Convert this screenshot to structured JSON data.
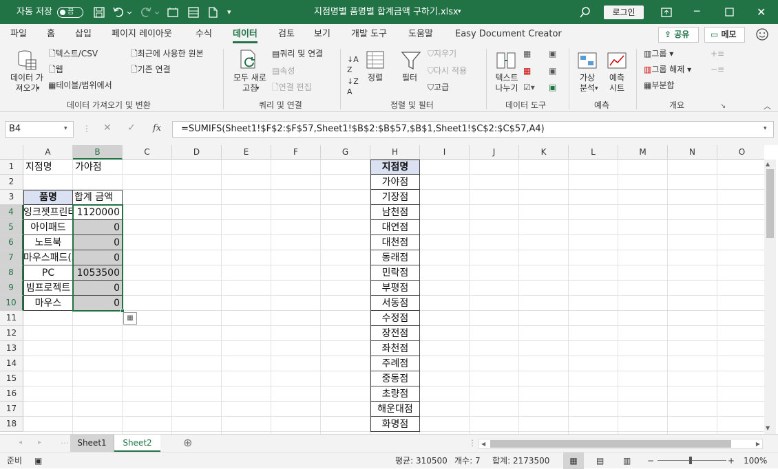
{
  "titlebar": {
    "autosave_label": "자동 저장",
    "autosave_state": "끔",
    "filename": "지점명별 품명별 합계금액 구하기.xlsx",
    "login_label": "로그인"
  },
  "menu": {
    "tabs": [
      "파일",
      "홈",
      "삽입",
      "페이지 레이아웃",
      "수식",
      "데이터",
      "검토",
      "보기",
      "개발 도구",
      "도움말",
      "Easy Document Creator"
    ],
    "active_tab": "데이터",
    "share_label": "공유",
    "memo_label": "메모"
  },
  "ribbon": {
    "get_data": "데이터 가\n져오기",
    "from_text_csv": "텍스트/CSV",
    "from_web": "웹",
    "from_table": "테이블/범위에서",
    "recent_sources": "최근에 사용한 원본",
    "existing_connections": "기존 연결",
    "group_get_transform": "데이터 가져오기 및 변환",
    "refresh_all": "모두 새로\n고침",
    "queries_connections": "쿼리 및 연결",
    "properties": "속성",
    "edit_links": "연결 편집",
    "group_queries": "쿼리 및 연결",
    "sort": "정렬",
    "filter": "필터",
    "clear": "지우기",
    "reapply": "다시 적용",
    "advanced": "고급",
    "group_sort_filter": "정렬 및 필터",
    "text_to_columns": "텍스트\n나누기",
    "group_data_tools": "데이터 도구",
    "what_if": "가상\n분석",
    "forecast_sheet": "예측\n시트",
    "group_forecast": "예측",
    "group": "그룹",
    "ungroup": "그룹 해제",
    "subtotal": "부분합",
    "group_outline": "개요"
  },
  "formula_bar": {
    "name_box": "B4",
    "formula": "=SUMIFS(Sheet1!$F$2:$F$57,Sheet1!$B$2:$B$57,$B$1,Sheet1!$C$2:$C$57,A4)"
  },
  "columns": [
    "A",
    "B",
    "C",
    "D",
    "E",
    "F",
    "G",
    "H",
    "I",
    "J",
    "K",
    "L",
    "M",
    "N",
    "O"
  ],
  "rows": [
    "1",
    "2",
    "3",
    "4",
    "5",
    "6",
    "7",
    "8",
    "9",
    "10",
    "11",
    "12",
    "13",
    "14",
    "15",
    "16",
    "17",
    "18"
  ],
  "cells": {
    "A1": "지점명",
    "B1": "가야점",
    "A3": "품명",
    "B3": "합계 금액",
    "items": [
      {
        "name": "잉크젯프린터",
        "value": "1120000"
      },
      {
        "name": "아이패드",
        "value": "0"
      },
      {
        "name": "노트북",
        "value": "0"
      },
      {
        "name": "마우스패드(스",
        "value": "0"
      },
      {
        "name": "PC",
        "value": "1053500"
      },
      {
        "name": "빔프로젝트",
        "value": "0"
      },
      {
        "name": "마우스",
        "value": "0"
      }
    ],
    "H1": "지점명",
    "branches": [
      "가야점",
      "기장점",
      "남천점",
      "대연점",
      "대천점",
      "동래점",
      "민락점",
      "부평점",
      "서동점",
      "수정점",
      "장전점",
      "좌천점",
      "주례점",
      "중동점",
      "초량점",
      "해운대점",
      "화명점"
    ]
  },
  "sheets": [
    "Sheet1",
    "Sheet2"
  ],
  "active_sheet": "Sheet2",
  "status": {
    "ready": "준비",
    "average": "평균: 310500",
    "count": "개수: 7",
    "sum": "합계: 2173500",
    "zoom": "100%"
  },
  "colors": {
    "excel_green": "#217346",
    "selection_fill": "#d0d0d0",
    "header_fill": "#d9e1f2"
  }
}
